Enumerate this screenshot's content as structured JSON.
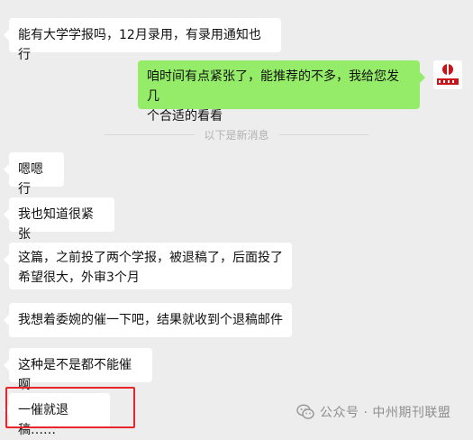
{
  "messages": {
    "m1": "能有大学学报吗，12月录用，有录用通知也行",
    "m2_line1": "咱时间有点紧张了，能推荐的不多，我给您发几",
    "m2_line2": "个合适的看看",
    "m3": "嗯嗯行",
    "m4": "我也知道很紧张",
    "m5_line1": "这篇，之前投了两个学报，被退稿了，后面投了",
    "m5_line2": "希望很大，外审3个月",
    "m6": "我想着委婉的催一下吧，结果就收到个退稿邮件",
    "m7": "这种是不是都不能催啊",
    "m8": "一催就退稿……"
  },
  "divider": {
    "label": "以下是新消息"
  },
  "avatar": {
    "logo_text": "中州期刊"
  },
  "watermark": {
    "text": "公众号 · 中州期刊联盟",
    "icon": "wechat-icon"
  },
  "colors": {
    "background": "#ededed",
    "received_bubble": "#ffffff",
    "sent_bubble": "#95ec69",
    "highlight_border": "#e8252b",
    "logo_red": "#c8151b"
  }
}
